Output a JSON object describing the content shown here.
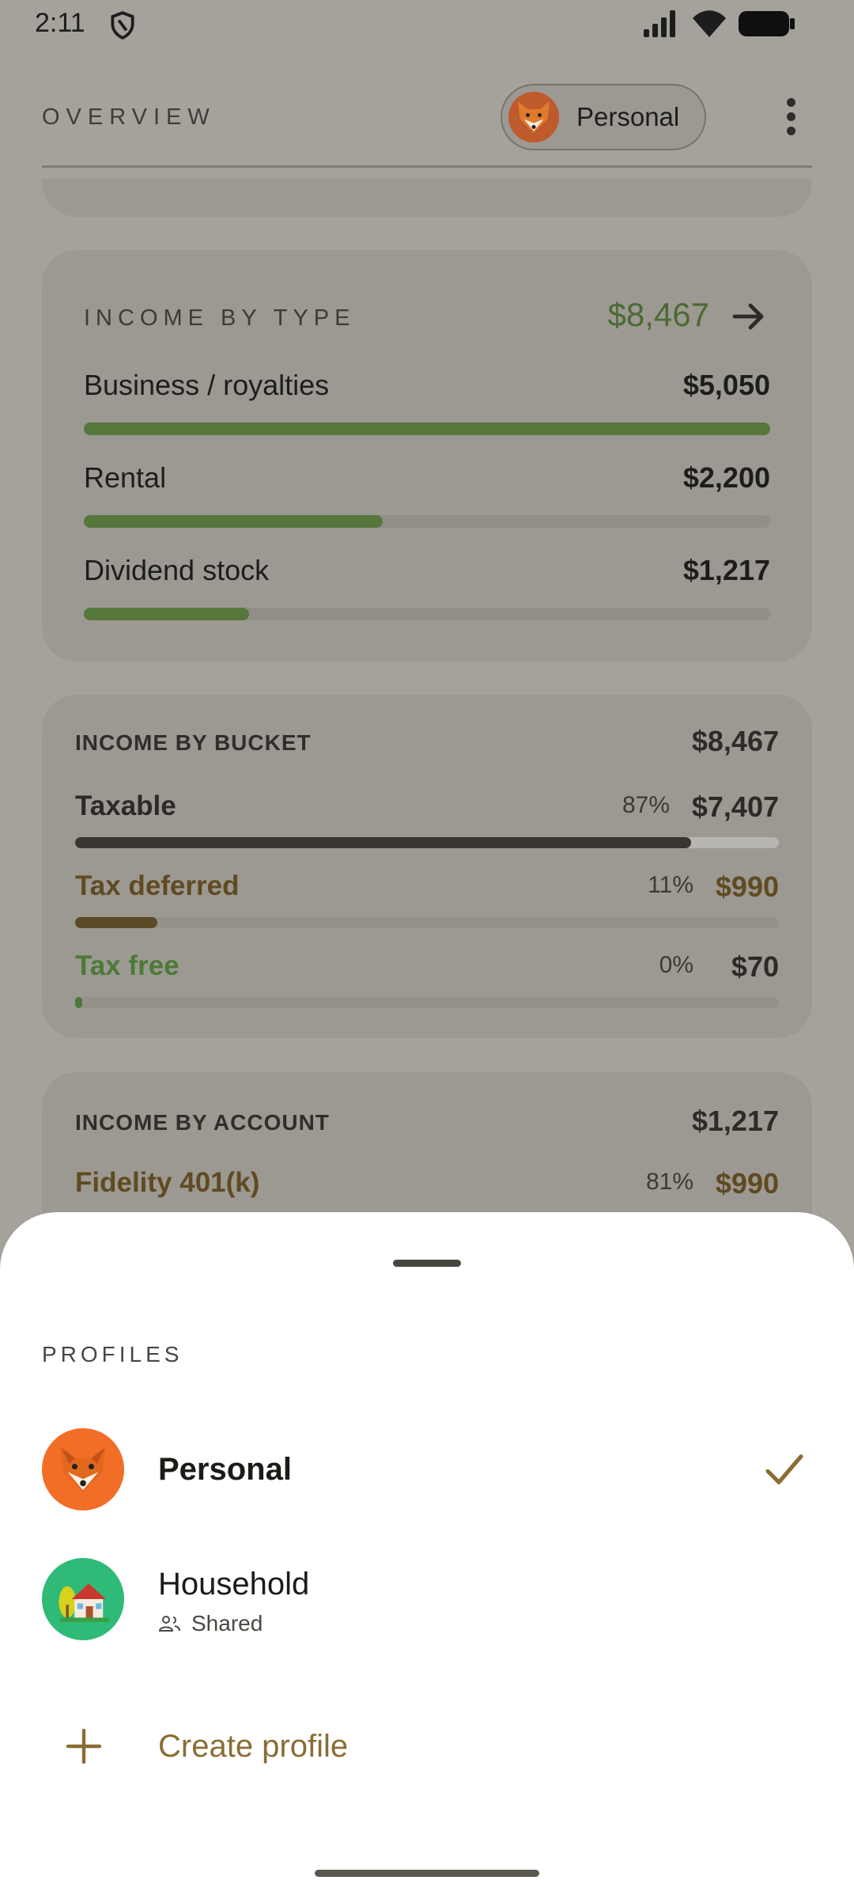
{
  "status": {
    "time": "2:11"
  },
  "header": {
    "title": "OVERVIEW",
    "profile_chip": "Personal"
  },
  "income_by_type": {
    "title": "INCOME BY TYPE",
    "total": "$8,467",
    "rows": [
      {
        "label": "Business / royalties",
        "value": "$5,050",
        "fill": 1.0
      },
      {
        "label": "Rental",
        "value": "$2,200",
        "fill": 0.436
      },
      {
        "label": "Dividend stock",
        "value": "$1,217",
        "fill": 0.241
      }
    ]
  },
  "income_by_bucket": {
    "title": "INCOME BY BUCKET",
    "total": "$8,467",
    "rows": [
      {
        "label": "Taxable",
        "pct": "87%",
        "value": "$7,407",
        "fill": 0.875
      },
      {
        "label": "Tax deferred",
        "pct": "11%",
        "value": "$990",
        "fill": 0.117
      },
      {
        "label": "Tax free",
        "pct": "0%",
        "value": "$70",
        "fill": 0.008
      }
    ]
  },
  "income_by_account": {
    "title": "INCOME BY ACCOUNT",
    "total": "$1,217",
    "rows": [
      {
        "label": "Fidelity 401(k)",
        "pct": "81%",
        "value": "$990"
      }
    ]
  },
  "sheet": {
    "title": "PROFILES",
    "profiles": [
      {
        "name": "Personal",
        "selected": true
      },
      {
        "name": "Household",
        "sub": "Shared"
      }
    ],
    "create_label": "Create profile"
  }
}
